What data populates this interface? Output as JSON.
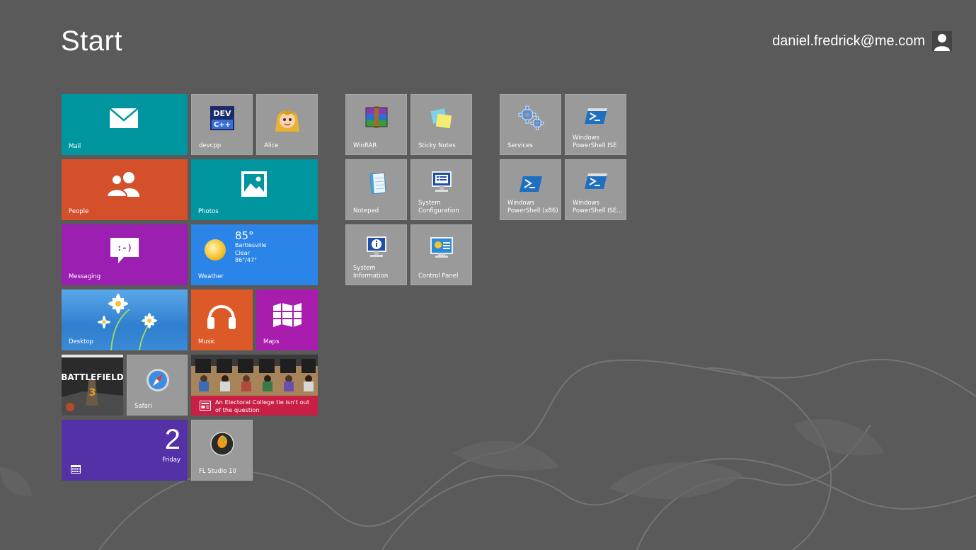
{
  "header": {
    "title": "Start",
    "user": "daniel.fredrick@me.com"
  },
  "tiles": {
    "mail": "Mail",
    "devcpp": "devcpp",
    "devcpp_icon_text_1": "DEV",
    "devcpp_icon_text_2": "C++",
    "alice": "Alice",
    "people": "People",
    "photos": "Photos",
    "messaging": "Messaging",
    "messaging_icon_text": ":-)",
    "weather": {
      "label": "Weather",
      "temp": "85°",
      "city": "Bartlesville",
      "condition": "Clear",
      "range": "86°/47°"
    },
    "desktop": "Desktop",
    "music": "Music",
    "maps": "Maps",
    "battlefield_text": "BATTLEFIELD",
    "battlefield_number": "3",
    "safari": "Safari",
    "news": "An Electoral College tie isn't out of the question",
    "calendar": {
      "day": "2",
      "weekday": "Friday"
    },
    "flstudio": "FL Studio 10",
    "winrar": "WinRAR",
    "sticky_notes": "Sticky Notes",
    "notepad": "Notepad",
    "system_configuration": "System\nConfiguration",
    "system_information": "System\nInformation",
    "control_panel": "Control Panel",
    "services": "Services",
    "ps_ise": "Windows\nPowerShell ISE",
    "ps_x86": "Windows\nPowerShell (x86)",
    "ps_ise_x86": "Windows\nPowerShell ISE..."
  },
  "colors": {
    "background": "#5a5a5a",
    "teal": "#00959f",
    "orange": "#d4502b",
    "purple": "#9b1fb0",
    "weather_blue": "#2b84e8",
    "calendar": "#5431a6",
    "news_red": "#c81f45",
    "app_gray": "#9a9a9a"
  }
}
